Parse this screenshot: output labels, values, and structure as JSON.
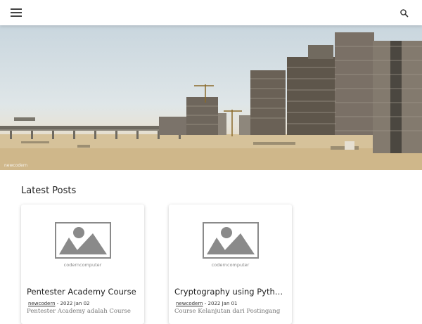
{
  "header": {
    "menu_icon": "hamburger-icon",
    "search_icon": "search-icon"
  },
  "hero": {
    "credit": "newcodern"
  },
  "main": {
    "section_title": "Latest Posts",
    "posts": [
      {
        "thumb_caption": "coderncomputer",
        "title": "Pentester Academy Course",
        "author": "newcodern",
        "separator": "-",
        "date": "2022 Jan 02",
        "excerpt": "Pentester Academy adalah Course"
      },
      {
        "thumb_caption": "coderncomputer",
        "title": "Cryptography using Pytho...",
        "author": "newcodern",
        "separator": "-",
        "date": "2022 Jan 01",
        "excerpt": "Course Kelanjutan dari Postingang"
      }
    ]
  },
  "colors": {
    "thumb_gray": "#8a8a8a",
    "text_dark": "#222222",
    "excerpt": "#777777"
  }
}
